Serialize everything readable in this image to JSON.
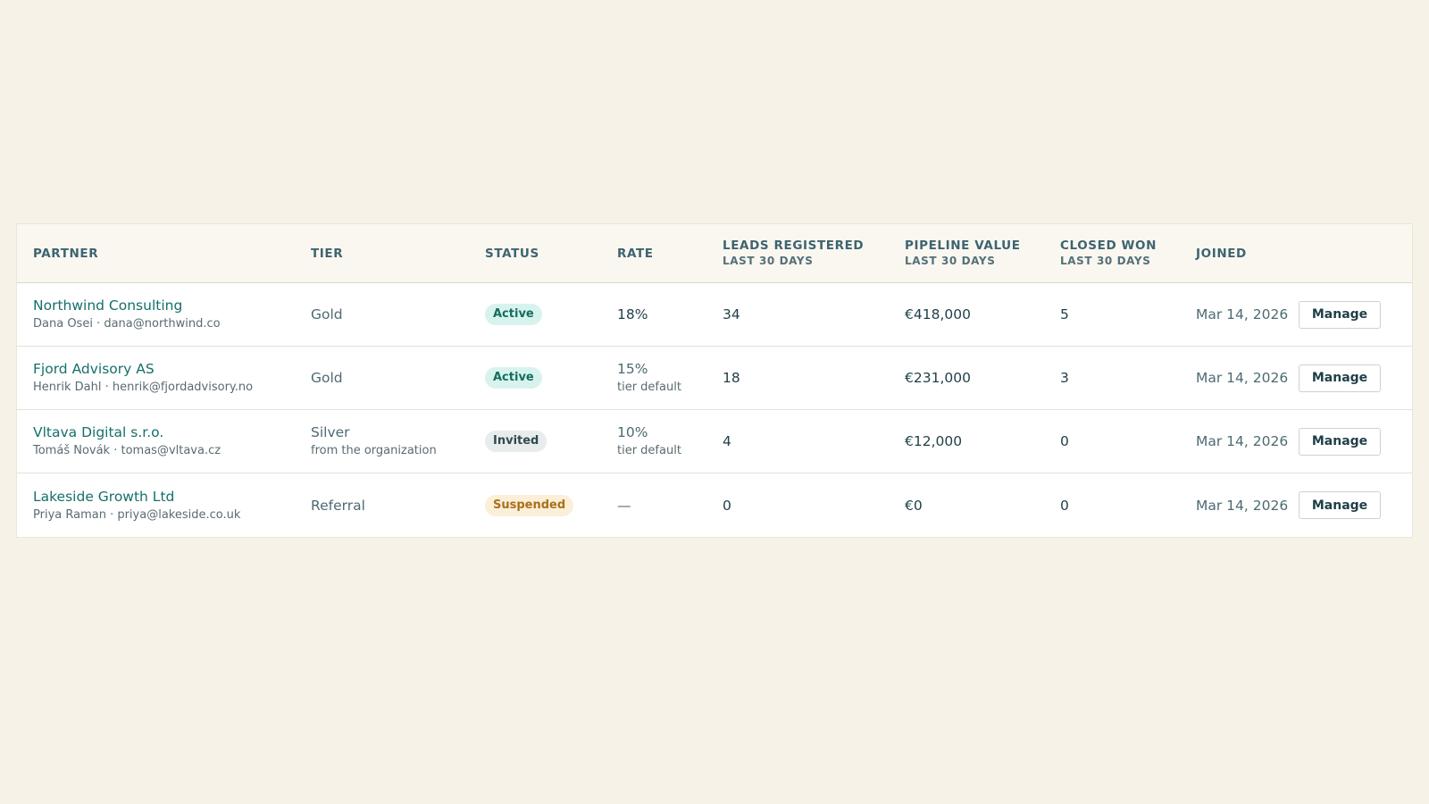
{
  "table": {
    "headers": {
      "partner": "PARTNER",
      "tier": "TIER",
      "status": "STATUS",
      "rate": "RATE",
      "leads": "LEADS REGISTERED",
      "leads_sub": "LAST 30 DAYS",
      "pipeline": "PIPELINE VALUE",
      "pipeline_sub": "LAST 30 DAYS",
      "closed": "CLOSED WON",
      "closed_sub": "LAST 30 DAYS",
      "joined": "JOINED"
    },
    "rows": [
      {
        "name": "Northwind Consulting",
        "contact": "Dana Osei · dana@northwind.co",
        "tier": "Gold",
        "tier_note": "",
        "status": "Active",
        "rate": "18%",
        "rate_note": "",
        "leads": "34",
        "pipeline": "€418,000",
        "closed": "5",
        "joined": "Mar 14, 2026",
        "action": "Manage"
      },
      {
        "name": "Fjord Advisory AS",
        "contact": "Henrik Dahl · henrik@fjordadvisory.no",
        "tier": "Gold",
        "tier_note": "",
        "status": "Active",
        "rate": "15%",
        "rate_note": "tier default",
        "leads": "18",
        "pipeline": "€231,000",
        "closed": "3",
        "joined": "Mar 14, 2026",
        "action": "Manage"
      },
      {
        "name": "Vltava Digital s.r.o.",
        "contact": "Tomáš Novák · tomas@vltava.cz",
        "tier": "Silver",
        "tier_note": "from the organization",
        "status": "Invited",
        "rate": "10%",
        "rate_note": "tier default",
        "leads": "4",
        "pipeline": "€12,000",
        "closed": "0",
        "joined": "Mar 14, 2026",
        "action": "Manage"
      },
      {
        "name": "Lakeside Growth Ltd",
        "contact": "Priya Raman · priya@lakeside.co.uk",
        "tier": "Referral",
        "tier_note": "",
        "status": "Suspended",
        "rate": "—",
        "rate_note": "",
        "leads": "0",
        "pipeline": "€0",
        "closed": "0",
        "joined": "Mar 14, 2026",
        "action": "Manage"
      }
    ]
  },
  "colors": {
    "background": "#f6f2e8",
    "partner_link": "#14706a",
    "active_badge_bg": "#d8f3ee",
    "invited_badge_bg": "#e9ecec",
    "suspended_badge_bg": "#fcefd8"
  }
}
